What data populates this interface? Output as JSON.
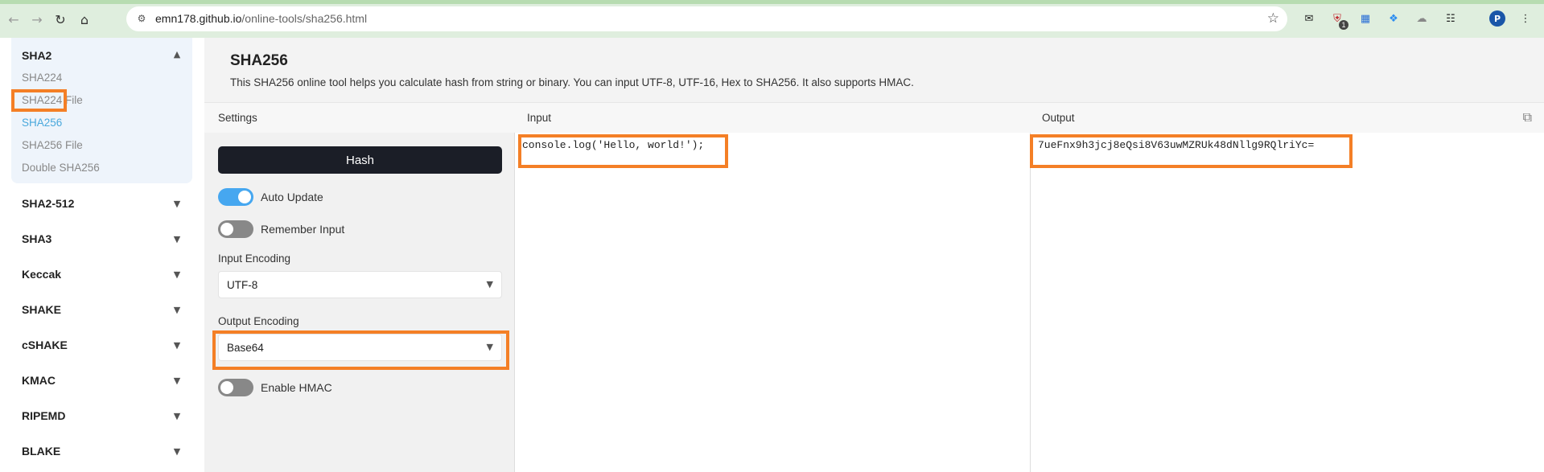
{
  "browser": {
    "url_host": "emn178.github.io",
    "url_path": "/online-tools/sha256.html",
    "extension_badge": "1",
    "profile_initial": "P"
  },
  "sidebar": {
    "open_group": {
      "label": "SHA2",
      "items": [
        {
          "label": "SHA224",
          "active": false
        },
        {
          "label": "SHA224 File",
          "active": false
        },
        {
          "label": "SHA256",
          "active": true
        },
        {
          "label": "SHA256 File",
          "active": false
        },
        {
          "label": "Double SHA256",
          "active": false
        }
      ]
    },
    "groups": [
      "SHA2-512",
      "SHA3",
      "Keccak",
      "SHAKE",
      "cSHAKE",
      "KMAC",
      "RIPEMD",
      "BLAKE"
    ]
  },
  "page": {
    "title": "SHA256",
    "description": "This SHA256 online tool helps you calculate hash from string or binary. You can input UTF-8, UTF-16, Hex to SHA256. It also supports HMAC."
  },
  "columns": {
    "settings": "Settings",
    "input": "Input",
    "output": "Output"
  },
  "settings": {
    "hash_button": "Hash",
    "auto_update": {
      "label": "Auto Update",
      "on": true
    },
    "remember_input": {
      "label": "Remember Input",
      "on": false
    },
    "input_encoding": {
      "label": "Input Encoding",
      "value": "UTF-8"
    },
    "output_encoding": {
      "label": "Output Encoding",
      "value": "Base64"
    },
    "enable_hmac": {
      "label": "Enable HMAC",
      "on": false
    }
  },
  "input_text": "console.log('Hello, world!');",
  "output_text": "7ueFnx9h3jcj8eQsi8V63uwMZRUk48dNllg9RQlriYc=",
  "colors": {
    "accent": "#4aa8dc",
    "highlight": "#f47f26",
    "button": "#1b1e27",
    "toggle_on": "#46a7f0"
  }
}
